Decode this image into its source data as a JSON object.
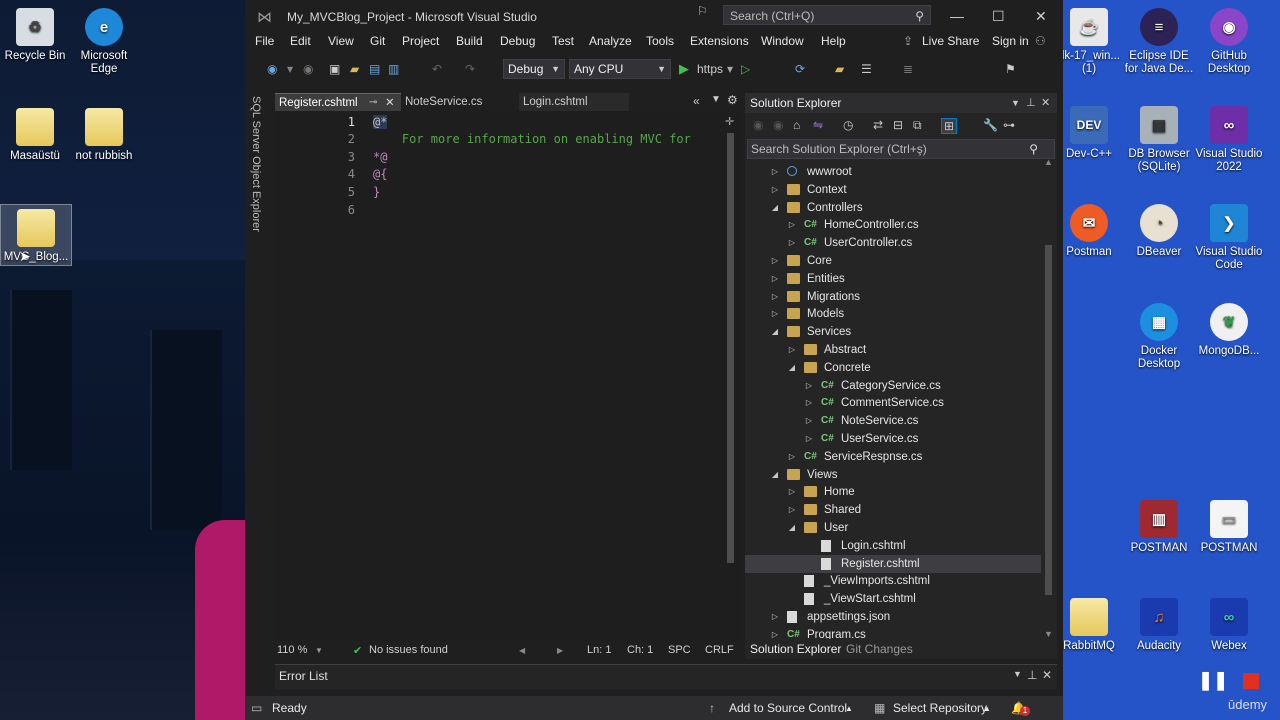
{
  "desktop": {
    "left_icons": [
      {
        "label": "Recycle Bin",
        "icon": "recycle-bin-icon"
      },
      {
        "label": "Microsoft Edge",
        "icon": "edge-icon"
      },
      {
        "label": "Masaüstü",
        "icon": "folder-icon"
      },
      {
        "label": "not rubbish",
        "icon": "folder-icon"
      },
      {
        "label": "MVC_Blog...",
        "icon": "folder-icon"
      }
    ],
    "right_icons": [
      {
        "label": "dk-17_win... (1)",
        "icon": "java-installer-icon"
      },
      {
        "label": "Eclipse IDE for Java De...",
        "icon": "eclipse-icon"
      },
      {
        "label": "GitHub Desktop",
        "icon": "github-icon"
      },
      {
        "label": "Dev-C++",
        "icon": "devcpp-icon"
      },
      {
        "label": "DB Browser (SQLite)",
        "icon": "db-browser-icon"
      },
      {
        "label": "Visual Studio 2022",
        "icon": "visual-studio-icon"
      },
      {
        "label": "Postman",
        "icon": "postman-icon"
      },
      {
        "label": "DBeaver",
        "icon": "dbeaver-icon"
      },
      {
        "label": "Visual Studio Code",
        "icon": "vscode-icon"
      },
      {
        "label": "Docker Desktop",
        "icon": "docker-icon"
      },
      {
        "label": "MongoDB...",
        "icon": "mongodb-icon"
      },
      {
        "label": "POSTMAN",
        "icon": "winrar-icon"
      },
      {
        "label": "POSTMAN",
        "icon": "file-icon"
      },
      {
        "label": "RabbitMQ",
        "icon": "folder-icon"
      },
      {
        "label": "Audacity",
        "icon": "audacity-icon"
      },
      {
        "label": "Webex",
        "icon": "webex-icon"
      }
    ],
    "watermark": "ūdemy"
  },
  "vs": {
    "title": "My_MVCBlog_Project - Microsoft Visual Studio",
    "search_placeholder": "Search (Ctrl+Q)",
    "menu": [
      "File",
      "Edit",
      "View",
      "Git",
      "Project",
      "Build",
      "Debug",
      "Test",
      "Analyze",
      "Tools",
      "Extensions",
      "Window",
      "Help"
    ],
    "live_share": "Live Share",
    "sign_in": "Sign in",
    "config": "Debug",
    "platform": "Any CPU",
    "run_target": "https",
    "side_panel": "SQL Server Object Explorer",
    "tabs": [
      "Register.cshtml",
      "NoteService.cs",
      "Login.cshtml"
    ],
    "code_lines": [
      {
        "num": "1",
        "text": "@*",
        "color": "#c0c0c0"
      },
      {
        "num": "2",
        "text": "    For more information on enabling MVC for",
        "color": "#57a64a"
      },
      {
        "num": "3",
        "text": "*@",
        "color": "#c586c0"
      },
      {
        "num": "4",
        "text": "@{",
        "color": "#c586c0"
      },
      {
        "num": "5",
        "text": "}",
        "color": "#c586c0"
      },
      {
        "num": "6",
        "text": "",
        "color": "#c0c0c0"
      }
    ],
    "editor_status": {
      "zoom": "110 %",
      "issues": "No issues found",
      "ln": "Ln: 1",
      "ch": "Ch: 1",
      "spc": "SPC",
      "crlf": "CRLF"
    },
    "error_list": "Error List",
    "status": {
      "ready": "Ready",
      "source_control": "Add to Source Control",
      "repository": "Select Repository",
      "notifications": "1"
    }
  },
  "solution_explorer": {
    "title": "Solution Explorer",
    "search_placeholder": "Search Solution Explorer (Ctrl+ş)",
    "bottom_tabs": [
      "Solution Explorer",
      "Git Changes"
    ],
    "tree": [
      {
        "label": "wwwroot",
        "depth": 0,
        "exp": "▷",
        "type": "globe"
      },
      {
        "label": "Context",
        "depth": 0,
        "exp": "▷",
        "type": "folder"
      },
      {
        "label": "Controllers",
        "depth": 0,
        "exp": "◢",
        "type": "folder"
      },
      {
        "label": "HomeController.cs",
        "depth": 1,
        "exp": "▷",
        "type": "cs"
      },
      {
        "label": "UserController.cs",
        "depth": 1,
        "exp": "▷",
        "type": "cs"
      },
      {
        "label": "Core",
        "depth": 0,
        "exp": "▷",
        "type": "folder"
      },
      {
        "label": "Entities",
        "depth": 0,
        "exp": "▷",
        "type": "folder"
      },
      {
        "label": "Migrations",
        "depth": 0,
        "exp": "▷",
        "type": "folder"
      },
      {
        "label": "Models",
        "depth": 0,
        "exp": "▷",
        "type": "folder"
      },
      {
        "label": "Services",
        "depth": 0,
        "exp": "◢",
        "type": "folder"
      },
      {
        "label": "Abstract",
        "depth": 1,
        "exp": "▷",
        "type": "folder"
      },
      {
        "label": "Concrete",
        "depth": 1,
        "exp": "◢",
        "type": "folder"
      },
      {
        "label": "CategoryService.cs",
        "depth": 2,
        "exp": "▷",
        "type": "cs"
      },
      {
        "label": "CommentService.cs",
        "depth": 2,
        "exp": "▷",
        "type": "cs"
      },
      {
        "label": "NoteService.cs",
        "depth": 2,
        "exp": "▷",
        "type": "cs"
      },
      {
        "label": "UserService.cs",
        "depth": 2,
        "exp": "▷",
        "type": "cs"
      },
      {
        "label": "ServiceRespnse.cs",
        "depth": 1,
        "exp": "▷",
        "type": "cs"
      },
      {
        "label": "Views",
        "depth": 0,
        "exp": "◢",
        "type": "folder"
      },
      {
        "label": "Home",
        "depth": 1,
        "exp": "▷",
        "type": "folder"
      },
      {
        "label": "Shared",
        "depth": 1,
        "exp": "▷",
        "type": "folder"
      },
      {
        "label": "User",
        "depth": 1,
        "exp": "◢",
        "type": "folder"
      },
      {
        "label": "Login.cshtml",
        "depth": 2,
        "exp": "",
        "type": "page"
      },
      {
        "label": "Register.cshtml",
        "depth": 2,
        "exp": "",
        "type": "page",
        "selected": true
      },
      {
        "label": "_ViewImports.cshtml",
        "depth": 1,
        "exp": "",
        "type": "page"
      },
      {
        "label": "_ViewStart.cshtml",
        "depth": 1,
        "exp": "",
        "type": "page"
      },
      {
        "label": "appsettings.json",
        "depth": 0,
        "exp": "▷",
        "type": "page"
      },
      {
        "label": "Program.cs",
        "depth": 0,
        "exp": "▷",
        "type": "cs"
      }
    ]
  }
}
